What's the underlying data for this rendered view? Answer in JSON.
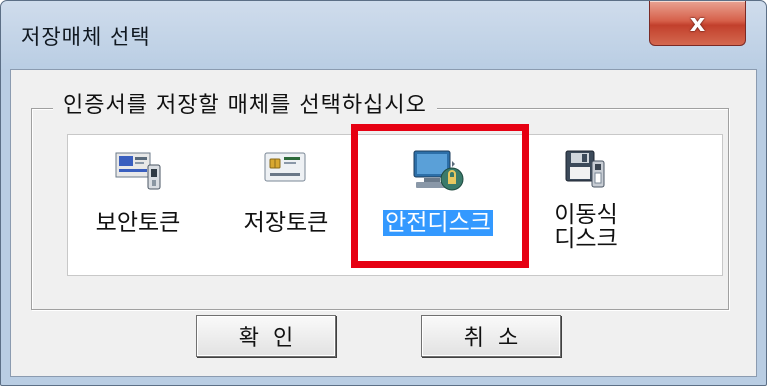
{
  "window": {
    "title": "저장매체 선택",
    "close_label": "x"
  },
  "group": {
    "legend": "인증서를 저장할 매체를 선택하십시오"
  },
  "media": [
    {
      "label": "보안토큰",
      "icon": "security-token-icon",
      "selected": false
    },
    {
      "label": "저장토큰",
      "icon": "storage-token-icon",
      "selected": false
    },
    {
      "label": "안전디스크",
      "icon": "secure-disk-icon",
      "selected": true
    },
    {
      "label_line1": "이동식",
      "label_line2": "디스크",
      "icon": "removable-disk-icon",
      "selected": false
    }
  ],
  "buttons": {
    "ok": "확인",
    "cancel": "취소"
  },
  "colors": {
    "highlight_box": "#e60012",
    "selection": "#3399ff",
    "close_button": "#c2402c"
  }
}
